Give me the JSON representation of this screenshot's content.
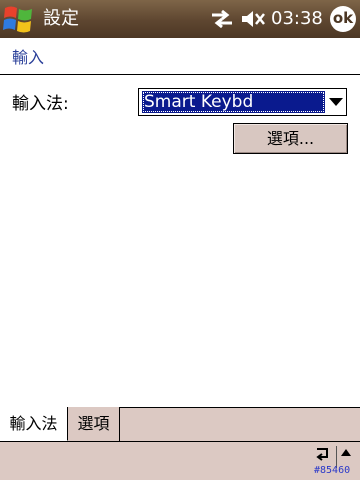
{
  "titlebar": {
    "title": "設定",
    "time": "03:38",
    "ok_label": "ok",
    "icons": [
      "windows-start-icon",
      "connectivity-icon",
      "speaker-muted-icon"
    ]
  },
  "page": {
    "header": "輸入"
  },
  "input_method": {
    "label": "輸入法:",
    "selected": "Smart Keybd"
  },
  "options_button": {
    "label": "選項..."
  },
  "tabs": [
    {
      "label": "輸入法",
      "active": true
    },
    {
      "label": "選項",
      "active": false
    }
  ],
  "cmdbar": {
    "build": "#85460"
  },
  "colors": {
    "titlebar": "#5e4630",
    "header_text": "#2a3f99",
    "selection": "#0a1a8e",
    "chrome": "#dcc9c3"
  }
}
